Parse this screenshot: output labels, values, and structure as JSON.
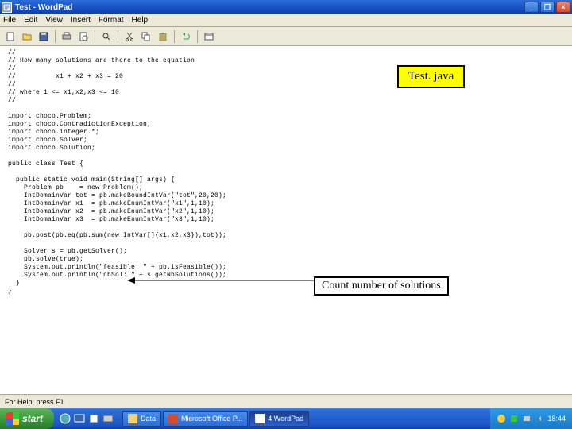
{
  "window": {
    "title": "Test - WordPad",
    "min_symbol": "_",
    "max_symbol": "❐",
    "close_symbol": "×"
  },
  "menu": {
    "items": [
      "File",
      "Edit",
      "View",
      "Insert",
      "Format",
      "Help"
    ]
  },
  "code": "//\n// How many solutions are there to the equation\n//\n//          x1 + x2 + x3 = 20\n//\n// where 1 <= x1,x2,x3 <= 10\n//\n\nimport choco.Problem;\nimport choco.ContradictionException;\nimport choco.integer.*;\nimport choco.Solver;\nimport choco.Solution;\n\npublic class Test {\n\n  public static void main(String[] args) {\n    Problem pb    = new Problem();\n    IntDomainVar tot = pb.makeBoundIntVar(\"tot\",20,20);\n    IntDomainVar x1  = pb.makeEnumIntVar(\"x1\",1,10);\n    IntDomainVar x2  = pb.makeEnumIntVar(\"x2\",1,10);\n    IntDomainVar x3  = pb.makeEnumIntVar(\"x3\",1,10);\n\n    pb.post(pb.eq(pb.sum(new IntVar[]{x1,x2,x3}),tot));\n\n    Solver s = pb.getSolver();\n    pb.solve(true);\n    System.out.println(\"feasible: \" + pb.isFeasible());\n    System.out.println(\"nbSol: \" + s.getNbSolutions());\n  }\n}",
  "annotations": {
    "filename": "Test. java",
    "countline": "Count number of solutions"
  },
  "statusbar": {
    "text": "For Help, press F1"
  },
  "taskbar": {
    "start": "start",
    "tasks": [
      {
        "label": "Data"
      },
      {
        "label": "Microsoft Office P..."
      },
      {
        "label": "4 WordPad"
      }
    ],
    "clock": "18:44"
  }
}
